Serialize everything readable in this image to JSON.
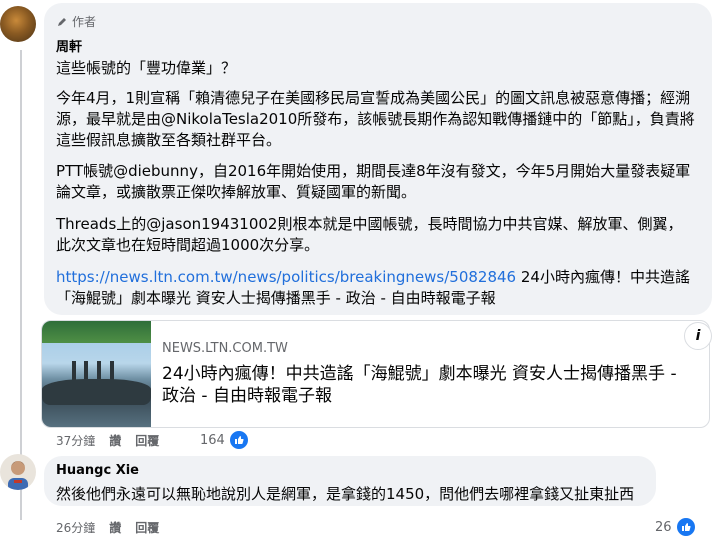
{
  "comment1": {
    "badge": "作者",
    "author": "周軒",
    "paragraphs": [
      "這些帳號的「豐功偉業」？",
      "今年4月，1則宣稱「賴清德兒子在美國移民局宣誓成為美國公民」的圖文訊息被惡意傳播；經溯源，最早就是由@NikolaTesla2010所發布，該帳號長期作為認知戰傳播鏈中的「節點」，負責將這些假訊息擴散至各類社群平台。",
      "PTT帳號@diebunny，自2016年開始使用，期間長達8年沒有發文，今年5月開始大量發表疑軍論文章，或擴散票正傑吹捧解放軍、質疑國軍的新聞。",
      "Threads上的@jason19431002則根本就是中國帳號，長時間協力中共官媒、解放軍、側翼，此次文章也在短時間超過1000次分享。"
    ],
    "link_url": "https://news.ltn.com.tw/news/politics/breakingnews/5082846",
    "link_text_after": " 24小時內瘋傳！中共造謠「海鯤號」劇本曝光 資安人士揭傳播黑手 - 政治 - 自由時報電子報",
    "preview": {
      "domain": "NEWS.LTN.COM.TW",
      "title": "24小時內瘋傳！中共造謠「海鯤號」劇本曝光 資安人士揭傳播黑手 - 政治 - 自由時報電子報",
      "info_icon": "i"
    },
    "actions": {
      "time": "37分鐘",
      "like": "讚",
      "reply": "回覆"
    },
    "reaction_count": "164"
  },
  "comment2": {
    "author": "Huangc Xie",
    "text": "然後他們永遠可以無恥地說別人是網軍，是拿錢的1450，問他們去哪裡拿錢又扯東扯西",
    "actions": {
      "time": "26分鐘",
      "like": "讚",
      "reply": "回覆"
    },
    "reaction_count": "26"
  },
  "colors": {
    "link": "#216fdb",
    "like_blue": "#1877f2",
    "bubble": "#f0f2f5",
    "meta_gray": "#65676b"
  }
}
